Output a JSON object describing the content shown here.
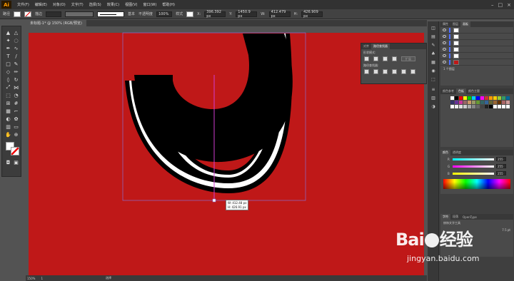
{
  "app": {
    "logo": "Ai",
    "logo_color": "#ff9a00"
  },
  "menubar": {
    "items": [
      "文件(F)",
      "编辑(E)",
      "对象(O)",
      "文字(T)",
      "选择(S)",
      "效果(C)",
      "视图(V)",
      "窗口(W)",
      "帮助(H)"
    ],
    "window_controls": [
      "–",
      "□",
      "×"
    ]
  },
  "control_bar": {
    "selection_label": "路径",
    "stroke_label": "描边",
    "stroke_profile": "基本",
    "opacity_label": "不透明度",
    "opacity_value": "100%",
    "style_label": "样式",
    "x_label": "X:",
    "x_value": "396.392 px",
    "y_label": "Y:",
    "y_value": "1450.9 px",
    "w_label": "W:",
    "w_value": "412.479 px",
    "h_label": "H:",
    "h_value": "426.909 px"
  },
  "document": {
    "tab_title": "未标题-1* @ 150% (RGB/预览)"
  },
  "canvas": {
    "artboard_color": "#bf1818",
    "info_tooltip": {
      "w": "W: 412.48 px",
      "h": "H: 426.91 px"
    }
  },
  "tools": [
    "selection",
    "direct-selection",
    "magic-wand",
    "lasso",
    "pen",
    "curvature",
    "type",
    "line",
    "rectangle",
    "paintbrush",
    "shaper",
    "pencil",
    "eraser",
    "rotate",
    "scale",
    "width",
    "free-transform",
    "shape-builder",
    "perspective-grid",
    "mesh",
    "gradient",
    "eyedropper",
    "blend",
    "symbol-sprayer",
    "column-graph",
    "artboard",
    "slice",
    "hand",
    "zoom"
  ],
  "status_bar": {
    "zoom": "150%",
    "page": "1",
    "tool": "选择"
  },
  "floating_panel": {
    "tabs": [
      "对齐",
      "路径查找器"
    ],
    "shape_modes_label": "形状模式:",
    "expand_button": "扩展",
    "pathfinders_label": "路径查找器:"
  },
  "right_panels": {
    "layers_tabs": [
      "属性",
      "图层",
      "画板"
    ],
    "layer_count_label": "1 个图层",
    "swatches_tabs": [
      "颜色参考",
      "色板",
      "颜色主题"
    ],
    "color_tabs": [
      "颜色",
      "透明度"
    ],
    "color_values": {
      "r": "255",
      "g": "255",
      "b": "255"
    },
    "type_tabs": [
      "字符",
      "段落",
      "OpenType"
    ],
    "type_tool_hint": "修饰文字工具",
    "font_size_value": "7.5 pt"
  },
  "watermark": {
    "brand": "Bai",
    "brand2": "经验",
    "site": "jingyan.baidu.com"
  }
}
